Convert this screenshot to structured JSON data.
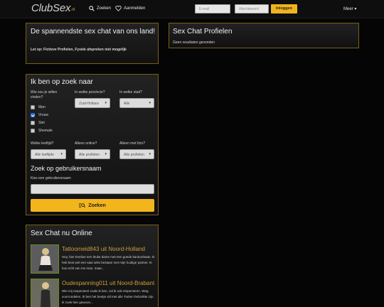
{
  "header": {
    "logo": "ClubSex",
    "logo_suffix": ".nl",
    "search_label": "Zoeken",
    "register_label": "Aanmelden",
    "email_placeholder": "E-mail",
    "password_placeholder": "Wachtwoord",
    "login_label": "Inloggen",
    "more_label": "Meer ▾"
  },
  "intro": {
    "title": "De spannendste sex chat van ons land!",
    "note": "Let op: Fictieve Profielen, Fysiek afspreken niet mogelijk"
  },
  "profiles_panel": {
    "title": "Sex Chat Profielen",
    "empty_text": "Geen resultaten gevonden"
  },
  "search_form": {
    "title": "Ik ben op zoek naar",
    "who_label": "Wie zou je willen vinden?",
    "options": [
      {
        "label": "Man",
        "checked": false
      },
      {
        "label": "Vrouw",
        "checked": true
      },
      {
        "label": "Stel",
        "checked": false
      },
      {
        "label": "Shemale",
        "checked": false
      }
    ],
    "province_label": "In welke provincie?",
    "province_value": "Zuid-Hollans",
    "city_label": "In welke stad?",
    "city_value": "Alle",
    "age_label": "Welke leeftijd?",
    "age_value": "Alle leeftijde",
    "online_label": "Alleen online?",
    "online_value": "Alle profielen",
    "photo_label": "Alleen met foto?",
    "photo_value": "Alle profielen",
    "username_title": "Zoek op gebruikersnaam",
    "username_label": "Kies een gebruikersnaam",
    "search_button": "Zoeken"
  },
  "online": {
    "title": "Sex Chat nu Online",
    "profiles": [
      {
        "name": "Tattoomeid843 uit Noord-Holland",
        "desc": "Hey, hier Eveline een leuke dame met een goede kantoorbaan. Ik heb best wel een saai seks bestaan met mijn huidige partner. Ik hou echt van me man, maar..."
      },
      {
        "name": "Oudespanning011 uit Noord-Brabant",
        "desc": "Wie mij respecteert zoals ik ben, zal ik ook respecteren. Weg voorrondelen. Ik ben het beetje stil met alle Turken hebzeltte zijn. Ik zoek hier gewoon..."
      }
    ]
  },
  "colors": {
    "accent": "#f0b41c",
    "panel_border": "#7a5f1a",
    "name_color": "#c9a13c",
    "checkbox_blue": "#1e73d8"
  }
}
